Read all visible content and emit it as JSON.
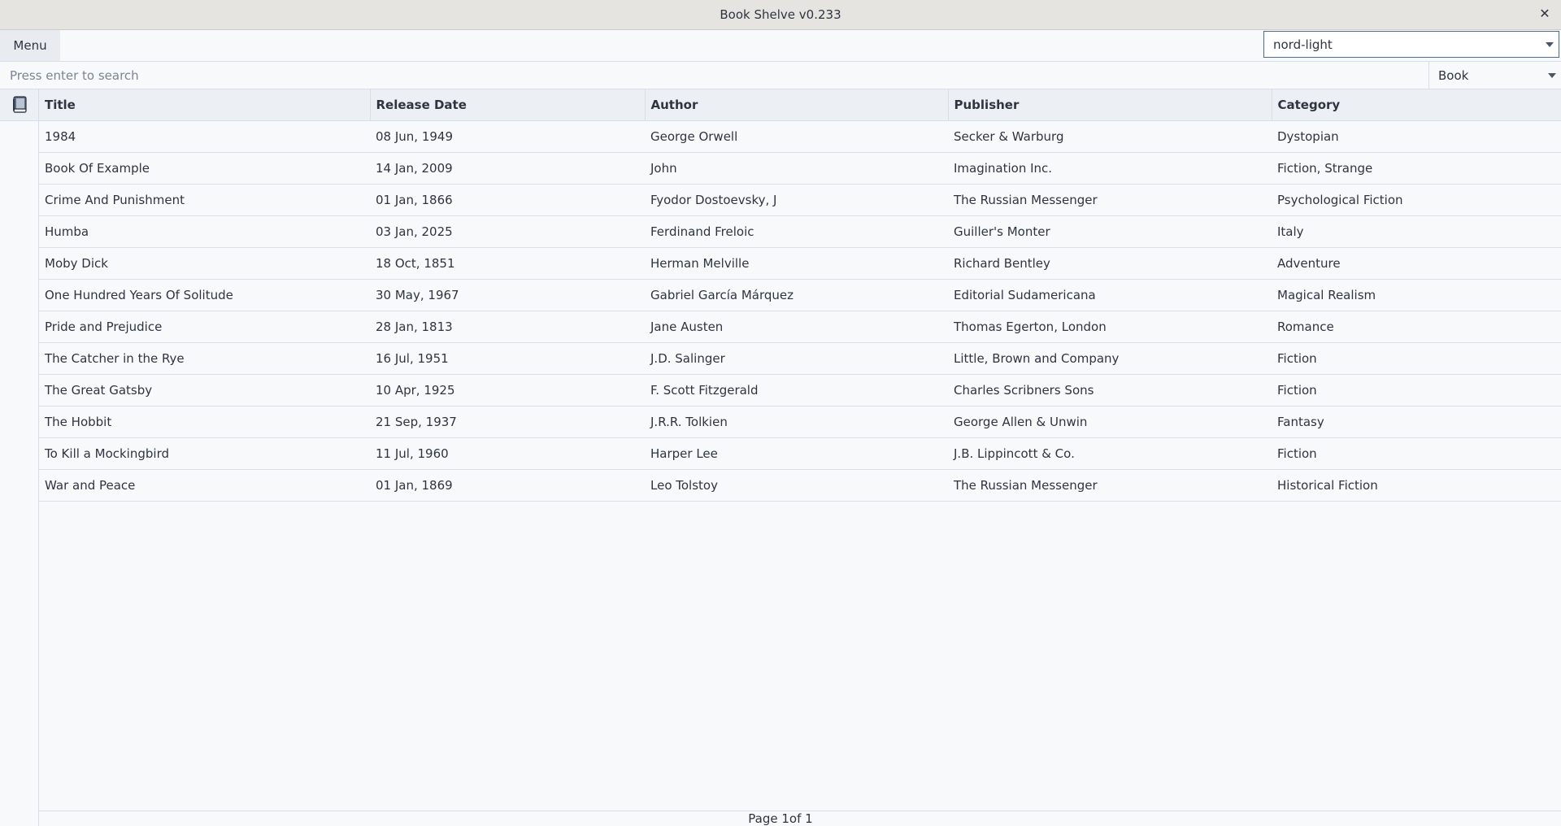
{
  "window": {
    "title": "Book Shelve v0.233",
    "close_label": "✕"
  },
  "menubar": {
    "menu_label": "Menu",
    "theme_value": "nord-light"
  },
  "search": {
    "placeholder": "Press enter to search",
    "type_value": "Book"
  },
  "table": {
    "columns": [
      "Title",
      "Release Date",
      "Author",
      "Publisher",
      "Category"
    ],
    "rows": [
      [
        "1984",
        "08 Jun, 1949",
        "George Orwell",
        "Secker & Warburg",
        "Dystopian"
      ],
      [
        "Book Of Example",
        "14 Jan, 2009",
        "John",
        "Imagination Inc.",
        "Fiction, Strange"
      ],
      [
        "Crime And Punishment",
        "01 Jan, 1866",
        "Fyodor Dostoevsky, J",
        "The Russian Messenger",
        "Psychological Fiction"
      ],
      [
        "Humba",
        "03 Jan, 2025",
        "Ferdinand Freloic",
        "Guiller's Monter",
        "Italy"
      ],
      [
        "Moby Dick",
        "18 Oct, 1851",
        "Herman Melville",
        "Richard Bentley",
        "Adventure"
      ],
      [
        "One Hundred Years Of Solitude",
        "30 May, 1967",
        "Gabriel García Márquez",
        "Editorial Sudamericana",
        "Magical Realism"
      ],
      [
        "Pride and Prejudice",
        "28 Jan, 1813",
        "Jane Austen",
        "Thomas Egerton, London",
        "Romance"
      ],
      [
        "The Catcher in the Rye",
        "16 Jul, 1951",
        "J.D. Salinger",
        "Little, Brown and Company",
        "Fiction"
      ],
      [
        "The Great Gatsby",
        "10 Apr, 1925",
        "F. Scott Fitzgerald",
        "Charles Scribners Sons",
        "Fiction"
      ],
      [
        "The Hobbit",
        "21 Sep, 1937",
        "J.R.R. Tolkien",
        "George Allen & Unwin",
        "Fantasy"
      ],
      [
        "To Kill a Mockingbird",
        "11 Jul, 1960",
        "Harper Lee",
        "J.B. Lippincott & Co.",
        "Fiction"
      ],
      [
        "War and Peace",
        "01 Jan, 1869",
        "Leo Tolstoy",
        "The Russian Messenger",
        "Historical Fiction"
      ]
    ]
  },
  "pager": {
    "text": "Page 1of 1"
  },
  "icons": {
    "corner": "book-icon",
    "close": "close-icon",
    "dropdown": "chevron-down-icon"
  },
  "colors": {
    "accent": "#4c6a93",
    "header_bg": "#eceff4",
    "border": "#d8dee9",
    "titlebar_bg": "#e6e4e1"
  }
}
